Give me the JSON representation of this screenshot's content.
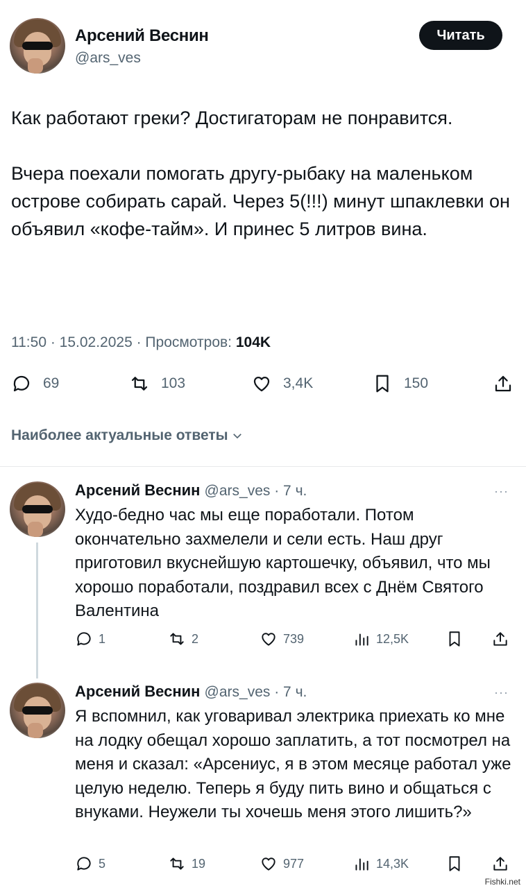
{
  "tweet": {
    "author_name": "Арсений Веснин",
    "author_handle": "@ars_ves",
    "read_button": "Читать",
    "paragraphs": [
      "Как работают греки? Достигаторам не понравится.",
      "Вчера поехали помогать другу-рыбаку на маленьком острове собирать сарай. Через 5(!!!) минут шпаклевки он объявил «кофе-тайм». И принес 5 литров вина."
    ],
    "meta_time": "11:50 · 15.02.2025 · Просмотров:",
    "meta_views": "104K",
    "actions": {
      "replies": "69",
      "reposts": "103",
      "likes": "3,4K",
      "bookmarks": "150"
    }
  },
  "best_replies_label": "Наиболее актуальные ответы",
  "replies": [
    {
      "name": "Арсений Веснин",
      "handle_time": "@ars_ves · 7 ч.",
      "text": "Худо-бедно час мы еще поработали. Потом окончательно захмелели и сели есть. Наш друг приготовил вкуснейшую  картошечку, объявил, что мы хорошо поработали, поздравил всех с Днём Святого Валентина",
      "replies": "1",
      "reposts": "2",
      "likes": "739",
      "views": "12,5K"
    },
    {
      "name": "Арсений Веснин",
      "handle_time": "@ars_ves · 7 ч.",
      "text": "Я вспомнил, как уговаривал электрика приехать ко мне на лодку обещал хорошо заплатить, а тот посмотрел на меня и сказал: «Арсениус, я в этом месяце работал уже целую неделю. Теперь я буду пить вино и общаться с внуками. Неужели ты хочешь меня этого лишить?»",
      "replies": "5",
      "reposts": "19",
      "likes": "977",
      "views": "14,3K"
    }
  ],
  "more_glyph": "···",
  "watermark": "Fishki.net"
}
